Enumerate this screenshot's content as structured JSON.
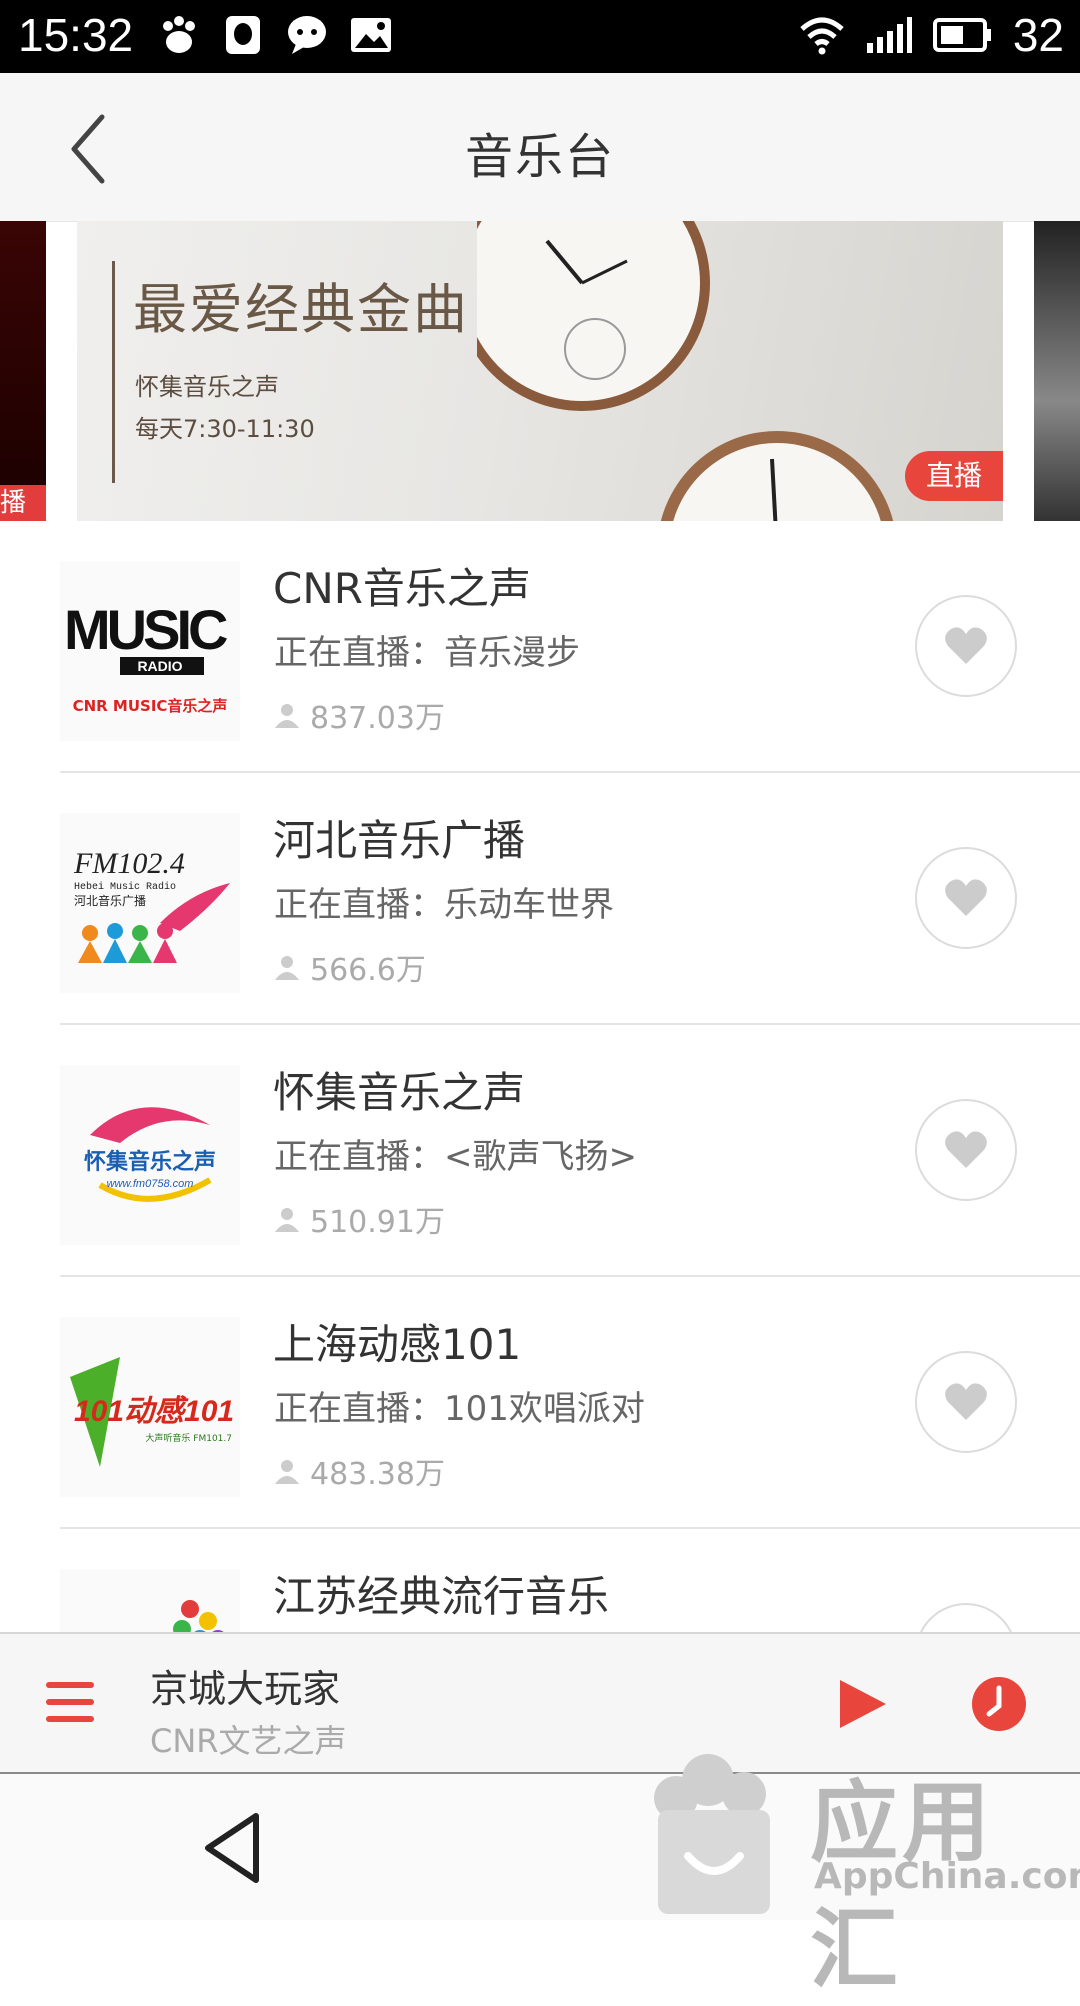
{
  "status_bar": {
    "time": "15:32",
    "battery": "32"
  },
  "header": {
    "title": "音乐台"
  },
  "banner": {
    "title": "最爱经典金曲",
    "station": "怀集音乐之声",
    "schedule": "每天7:30-11:30",
    "live_tag": "直播",
    "prev_tag": "播"
  },
  "stations": [
    {
      "name": "CNR音乐之声",
      "live": "正在直播：音乐漫步",
      "listeners": "837.03万",
      "logo_text": "MUSIC",
      "logo_sub": "RADIO",
      "logo_small": "CNR MUSIC音乐之声"
    },
    {
      "name": "河北音乐广播",
      "live": "正在直播：乐动车世界",
      "listeners": "566.6万",
      "logo_text": "FM102.4",
      "logo_sub": "Hebei Music Radio",
      "logo_small": "河北音乐广播"
    },
    {
      "name": "怀集音乐之声",
      "live": "正在直播：<歌声飞扬>",
      "listeners": "510.91万",
      "logo_text": "怀集音乐之声",
      "logo_sub": "www.fm0758.com"
    },
    {
      "name": "上海动感101",
      "live": "正在直播：101欢唱派对",
      "listeners": "483.38万",
      "logo_text": "101动感101",
      "logo_sub": "大声听音乐 FM101.7"
    },
    {
      "name": "江苏经典流行音乐",
      "live": "",
      "listeners": ""
    }
  ],
  "player": {
    "title": "京城大玩家",
    "subtitle": "CNR文艺之声"
  },
  "watermark": {
    "cn": "应用汇",
    "en": "AppChina.com"
  },
  "colors": {
    "accent": "#e8453c",
    "header_bg": "#f6f6f6"
  }
}
